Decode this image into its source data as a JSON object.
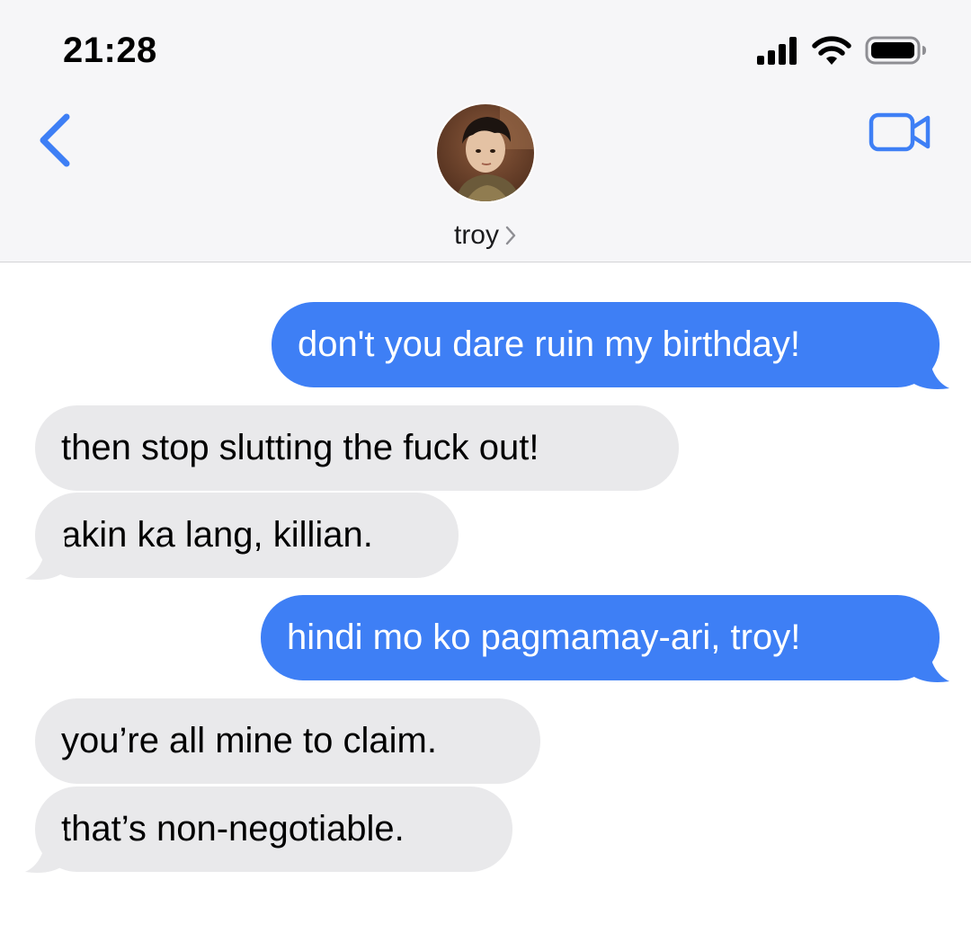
{
  "status_bar": {
    "time": "21:28",
    "icons": [
      "cellular-signal-icon",
      "wifi-icon",
      "battery-icon"
    ]
  },
  "header": {
    "back_icon": "chevron-left-icon",
    "contact_name": "troy",
    "contact_chevron_icon": "chevron-right-icon",
    "video_icon": "video-camera-icon"
  },
  "colors": {
    "accent": "#3e7ff5",
    "sent_bubble": "#3e7ff5",
    "received_bubble": "#e9e9eb",
    "header_bg": "#f6f6f8"
  },
  "messages": [
    {
      "direction": "sent",
      "text": "don't you dare ruin my birthday!"
    },
    {
      "direction": "received",
      "text": "then stop slutting the fuck out!"
    },
    {
      "direction": "received",
      "text": "akin ka lang, killian."
    },
    {
      "direction": "sent",
      "text": "hindi mo ko pagmamay-ari, troy!"
    },
    {
      "direction": "received",
      "text": "you’re all mine to claim."
    },
    {
      "direction": "received",
      "text": "that’s non-negotiable."
    }
  ]
}
